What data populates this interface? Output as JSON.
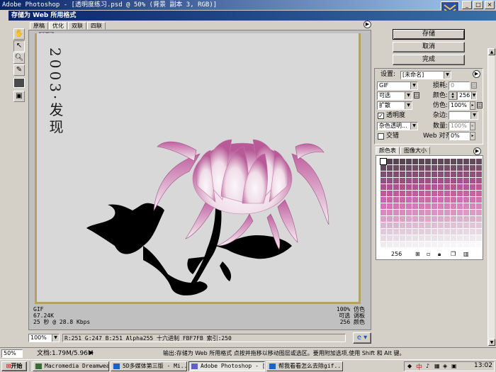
{
  "window_title": "Adobe Photoshop - [透明度练习.psd @ 50% (背景 副本 3, RGB)]",
  "dialog_title": "存储为 Web 所用格式",
  "view_tabs": [
    "原稿",
    "优化",
    "双联",
    "四联"
  ],
  "artwork_text": "2003·发现",
  "image_info_left": [
    "GIF",
    "67.24K",
    "25 秒 @ 28.8 Kbps"
  ],
  "image_info_right": [
    "100% 仿色",
    "可选 调板",
    "256 颜色"
  ],
  "zoom_select": "100%",
  "pixel_info": "R:251  G:247  B:251  Alpha255  十六进制  FBF7FB  索引:250",
  "buttons": {
    "save": "存储",
    "cancel": "取消",
    "done": "完成"
  },
  "settings": {
    "settings_label": "设置:",
    "settings_value": "[未命名]",
    "format": "GIF",
    "lossy_label": "损耗:",
    "lossy_value": "0",
    "reduction": "可选",
    "colors_label": "颜色:",
    "colors_value": "256",
    "dither_algo": "扩散",
    "dither_label": "仿色:",
    "dither_value": "100%",
    "transparency_label": "透明度",
    "matte_label": "杂边:",
    "trans_dither": "杂色透明...",
    "amount_label": "数量:",
    "amount_value": "100%",
    "interlaced_label": "交错",
    "web_snap_label": "Web 对齐:",
    "web_snap_value": "0%"
  },
  "palette_tabs": [
    "颜色表",
    "图像大小"
  ],
  "palette_count": "256",
  "bottom_status": {
    "zoom": "50%",
    "doc_info": "文档:1.79M/5.96M",
    "hint": "输出:存储为 Web 所用格式  点按并拖移以移动图层或选区。要用附加选项,使用 Shift 和 Alt 键。"
  },
  "taskbar": {
    "start": "开始",
    "tasks": [
      "Macromedia Dreamwea...",
      "5D多媒体第三版 - Mi...",
      "Adobe Photoshop - [...",
      "帮我看看怎么去除gif..."
    ],
    "ime": "中",
    "clock": "13:02"
  },
  "colors": {
    "title_dark": "#0a246a",
    "title_light": "#a6caf0",
    "canvas_bg": "#d8d8d8",
    "petal": "#c878b0",
    "petal_light": "#f4eef0",
    "silhouette": "#000000"
  }
}
